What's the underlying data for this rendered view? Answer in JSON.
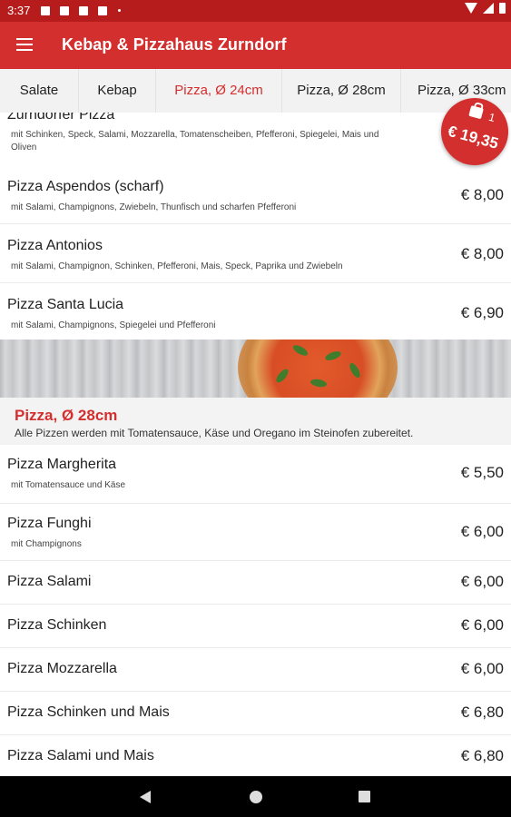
{
  "status_bar": {
    "time": "3:37"
  },
  "app_bar": {
    "title": "Kebap & Pizzahaus Zurndorf"
  },
  "tabs": [
    {
      "label": "Salate"
    },
    {
      "label": "Kebap"
    },
    {
      "label": "Pizza, Ø 24cm",
      "active": true
    },
    {
      "label": "Pizza, Ø 28cm"
    },
    {
      "label": "Pizza, Ø 33cm"
    }
  ],
  "items_top": [
    {
      "name": "Zurndorfer Pizza",
      "desc": "mit Schinken, Speck, Salami, Mozzarella, Tomatenscheiben, Pfefferoni, Spiegelei, Mais und Oliven",
      "price": ""
    },
    {
      "name": "Pizza Aspendos (scharf)",
      "desc": "mit Salami, Champignons, Zwiebeln, Thunfisch und scharfen Pfefferoni",
      "price": "€ 8,00"
    },
    {
      "name": "Pizza Antonios",
      "desc": "mit Salami, Champignon, Schinken, Pfefferoni, Mais, Speck, Paprika und Zwiebeln",
      "price": "€ 8,00"
    },
    {
      "name": "Pizza Santa Lucia",
      "desc": "mit Salami, Champignons, Spiegelei und Pfefferoni",
      "price": "€ 6,90"
    }
  ],
  "section": {
    "title": "Pizza, Ø 28cm",
    "desc": "Alle Pizzen werden mit Tomatensauce, Käse und Oregano im Steinofen zubereitet."
  },
  "items_bottom": [
    {
      "name": "Pizza Margherita",
      "desc": "mit Tomatensauce und Käse",
      "price": "€ 5,50"
    },
    {
      "name": "Pizza Funghi",
      "desc": "mit Champignons",
      "price": "€ 6,00"
    },
    {
      "name": "Pizza Salami",
      "desc": "",
      "price": "€ 6,00"
    },
    {
      "name": "Pizza Schinken",
      "desc": "",
      "price": "€ 6,00"
    },
    {
      "name": "Pizza Mozzarella",
      "desc": "",
      "price": "€ 6,00"
    },
    {
      "name": "Pizza Schinken und Mais",
      "desc": "",
      "price": "€ 6,80"
    },
    {
      "name": "Pizza Salami und Mais",
      "desc": "",
      "price": "€ 6,80"
    }
  ],
  "cart": {
    "count": "1",
    "total": "€ 19,35"
  },
  "colors": {
    "primary": "#d32f2f",
    "status_bar": "#b71c1c",
    "section_bg": "#f3f3f3"
  },
  "icons": [
    "menu-icon",
    "cart-icon",
    "back-icon",
    "home-icon",
    "recents-icon",
    "wifi-icon",
    "signal-icon",
    "battery-icon"
  ]
}
